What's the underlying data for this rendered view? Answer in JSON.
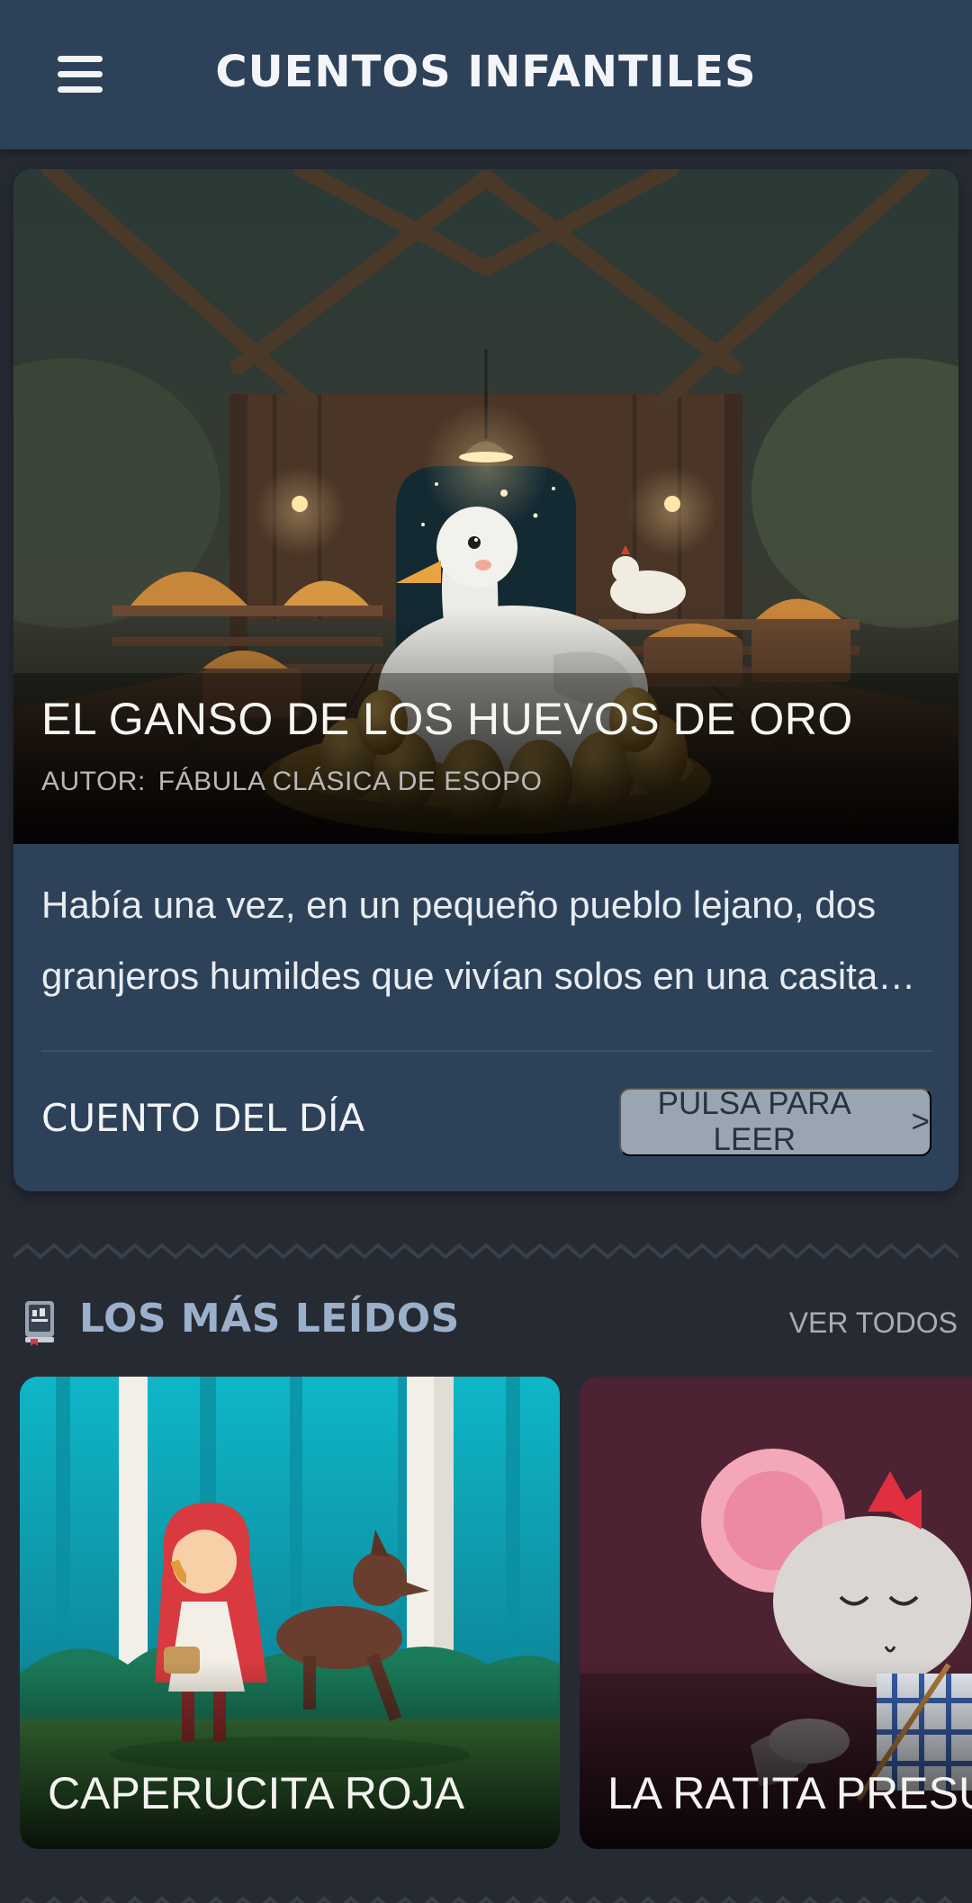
{
  "app_bar": {
    "title": "CUENTOS INFANTILES",
    "menu_icon": "hamburger-menu-icon"
  },
  "featured": {
    "title": "EL GANSO DE LOS HUEVOS DE ORO",
    "author_label": "AUTOR:",
    "author": "FÁBULA CLÁSICA DE ESOPO",
    "excerpt": "Había una vez, en un pequeño pueblo lejano, dos granjeros humildes que vivían solos en una casita d...",
    "label": "CUENTO DEL DÍA",
    "read_button": "PULSA PARA LEER",
    "read_button_icon": "chevron-right-icon"
  },
  "most_read": {
    "title": "LOS MÁS LEÍDOS",
    "icon": "book-stack-icon",
    "see_all": "VER TODOS",
    "stories": [
      {
        "title": "CAPERUCITA ROJA"
      },
      {
        "title": "LA RATITA PRESUMIDA"
      }
    ]
  },
  "colors": {
    "app_bar": "#2d4259",
    "background": "#262a33",
    "card": "#2d4259",
    "button": "#99a5b0",
    "section_title": "#9ab0cb"
  }
}
